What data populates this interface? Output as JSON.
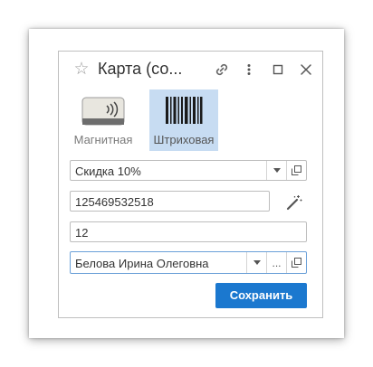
{
  "dialog": {
    "title": "Карта (со...",
    "icons": [
      "star-icon",
      "link-icon",
      "more-icon",
      "maximize-icon",
      "close-icon"
    ]
  },
  "card_types": [
    {
      "label": "Магнитная",
      "icon": "magnetic-card-icon",
      "selected": false
    },
    {
      "label": "Штриховая",
      "icon": "barcode-icon",
      "selected": true
    }
  ],
  "fields": {
    "discount": {
      "value": "Скидка 10%"
    },
    "card_number": {
      "value": "125469532518"
    },
    "quantity": {
      "value": "12"
    },
    "owner": {
      "value": "Белова Ирина Олеговна",
      "select_label": "..."
    }
  },
  "buttons": {
    "save": "Сохранить"
  },
  "colors": {
    "accent": "#1b78cf",
    "selected_bg": "#c7dcf2"
  }
}
